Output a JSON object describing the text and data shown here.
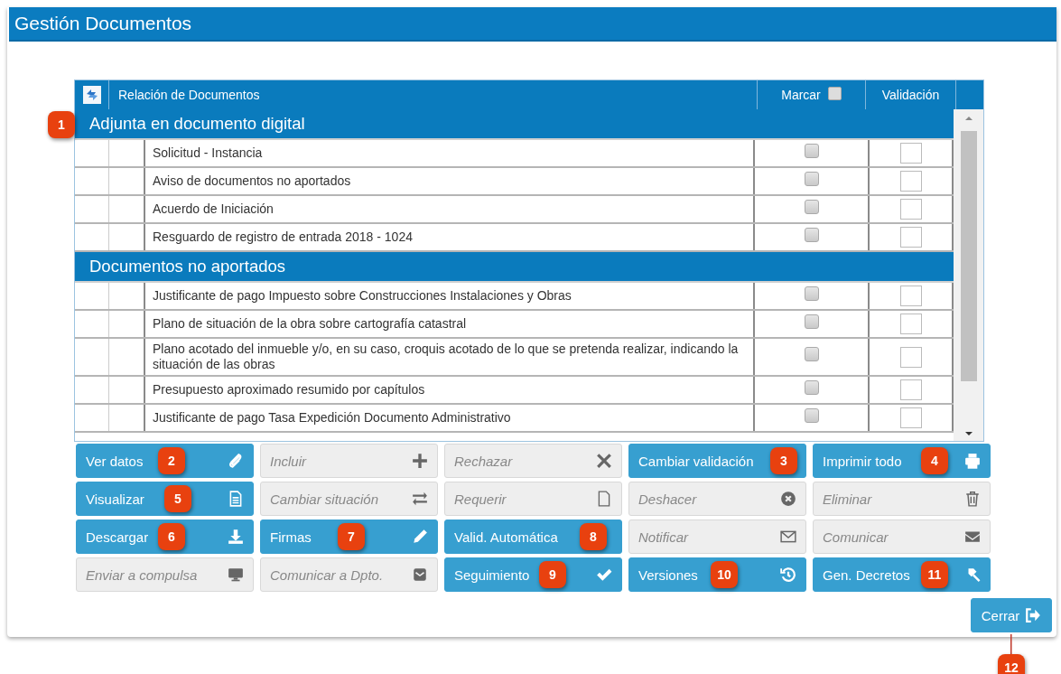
{
  "title": "Gestión Documentos",
  "table": {
    "columns": [
      {
        "label": "Relación de Documentos"
      },
      {
        "label": "Marcar",
        "checked": false
      },
      {
        "label": "Validación"
      }
    ],
    "groups": [
      {
        "title": "Adjunta en documento digital",
        "callout": "1",
        "rows": [
          {
            "text": "Solicitud - Instancia",
            "marked": false,
            "validated": false
          },
          {
            "text": "Aviso de documentos no aportados",
            "marked": false,
            "validated": false
          },
          {
            "text": "Acuerdo de Iniciación",
            "marked": false,
            "validated": false
          },
          {
            "text": "Resguardo de registro de entrada 2018 - 1024",
            "marked": false,
            "validated": false
          }
        ]
      },
      {
        "title": "Documentos no aportados",
        "rows": [
          {
            "text": "Justificante de pago Impuesto sobre Construcciones Instalaciones y Obras",
            "marked": false,
            "validated": false
          },
          {
            "text": "Plano de situación de la obra sobre cartografía catastral",
            "marked": false,
            "validated": false
          },
          {
            "text": "Plano acotado del inmueble y/o, en su caso, croquis acotado de lo que se pretenda realizar, indicando la situación de las obras",
            "marked": false,
            "validated": false
          },
          {
            "text": "Presupuesto aproximado resumido por capítulos",
            "marked": false,
            "validated": false
          },
          {
            "text": "Justificante de pago Tasa Expedición Documento Administrativo",
            "marked": false,
            "validated": false
          }
        ]
      }
    ]
  },
  "buttons": [
    {
      "label": "Ver datos",
      "disabled": false,
      "callout": "2"
    },
    {
      "label": "Incluir",
      "disabled": true
    },
    {
      "label": "Rechazar",
      "disabled": true
    },
    {
      "label": "Cambiar validación",
      "disabled": false,
      "callout": "3"
    },
    {
      "label": "Imprimir todo",
      "disabled": false,
      "callout": "4"
    },
    {
      "label": "Visualizar",
      "disabled": false,
      "callout": "5"
    },
    {
      "label": "Cambiar situación",
      "disabled": true
    },
    {
      "label": "Requerir",
      "disabled": true
    },
    {
      "label": "Deshacer",
      "disabled": true
    },
    {
      "label": "Eliminar",
      "disabled": true
    },
    {
      "label": "Descargar",
      "disabled": false,
      "callout": "6"
    },
    {
      "label": "Firmas",
      "disabled": false,
      "callout": "7"
    },
    {
      "label": "Valid. Automática",
      "disabled": false,
      "callout": "8"
    },
    {
      "label": "Notificar",
      "disabled": true
    },
    {
      "label": "Comunicar",
      "disabled": true
    },
    {
      "label": "Enviar a compulsa",
      "disabled": true
    },
    {
      "label": "Comunicar a Dpto.",
      "disabled": true
    },
    {
      "label": "Seguimiento",
      "disabled": false,
      "callout": "9"
    },
    {
      "label": "Versiones",
      "disabled": false,
      "callout": "10"
    },
    {
      "label": "Gen. Decretos",
      "disabled": false,
      "callout": "11"
    }
  ],
  "close_button": {
    "label": "Cerrar",
    "callout": "12"
  }
}
